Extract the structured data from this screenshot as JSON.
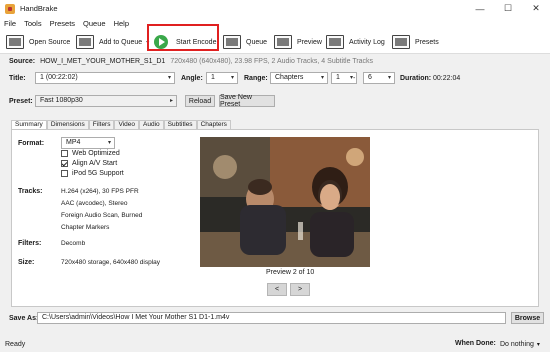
{
  "window": {
    "title": "HandBrake",
    "minimize": "—",
    "maximize": "☐",
    "close": "✕"
  },
  "menu": [
    "File",
    "Tools",
    "Presets",
    "Queue",
    "Help"
  ],
  "toolbar": {
    "open_source": "Open Source",
    "add_to_queue": "Add to Queue",
    "add_to_queue_arrow": "▾",
    "start_encode": "Start Encode",
    "queue": "Queue",
    "preview": "Preview",
    "activity_log": "Activity Log",
    "presets": "Presets"
  },
  "source": {
    "label": "Source:",
    "name": "HOW_I_MET_YOUR_MOTHER_S1_D1",
    "meta": "720x480 (640x480), 23.98 FPS, 2 Audio Tracks, 4 Subtitle Tracks"
  },
  "title_row": {
    "title_label": "Title:",
    "title_value": "1 (00:22:02)",
    "angle_label": "Angle:",
    "angle_value": "1",
    "range_label": "Range:",
    "range_type": "Chapters",
    "range_start": "1",
    "range_dash": "-",
    "range_end": "6",
    "duration_label": "Duration:",
    "duration_value": "00:22:04"
  },
  "preset_row": {
    "label": "Preset:",
    "value": "Fast 1080p30",
    "arrow": "▸",
    "reload": "Reload",
    "save_new": "Save New Preset"
  },
  "tabs": [
    "Summary",
    "Dimensions",
    "Filters",
    "Video",
    "Audio",
    "Subtitles",
    "Chapters"
  ],
  "summary": {
    "format_label": "Format:",
    "format_value": "MP4",
    "options": [
      {
        "label": "Web Optimized",
        "checked": false
      },
      {
        "label": "Align A/V Start",
        "checked": true
      },
      {
        "label": "iPod 5G Support",
        "checked": false
      }
    ],
    "tracks_label": "Tracks:",
    "tracks": [
      "H.264 (x264), 30 FPS PFR",
      "AAC (avcodec), Stereo",
      "Foreign Audio Scan, Burned",
      "Chapter Markers"
    ],
    "filters_label": "Filters:",
    "filters_value": "Decomb",
    "size_label": "Size:",
    "size_value": "720x480 storage, 640x480 display",
    "preview_caption": "Preview 2 of 10",
    "prev": "<",
    "next": ">"
  },
  "save_as": {
    "label": "Save As:",
    "path": "C:\\Users\\admin\\Videos\\How I Met Your Mother S1 D1-1.m4v",
    "browse": "Browse"
  },
  "status": {
    "text": "Ready",
    "when_done_label": "When Done:",
    "when_done_value": "Do nothing",
    "when_done_arrow": "▾"
  },
  "colors": {
    "highlight": "#e02020",
    "start_encode": "#3aa84a"
  },
  "icons": [
    "handbrake-app-icon",
    "film-icon",
    "add-queue-icon",
    "play-icon",
    "queue-icon",
    "preview-icon",
    "activity-log-icon",
    "presets-icon"
  ]
}
